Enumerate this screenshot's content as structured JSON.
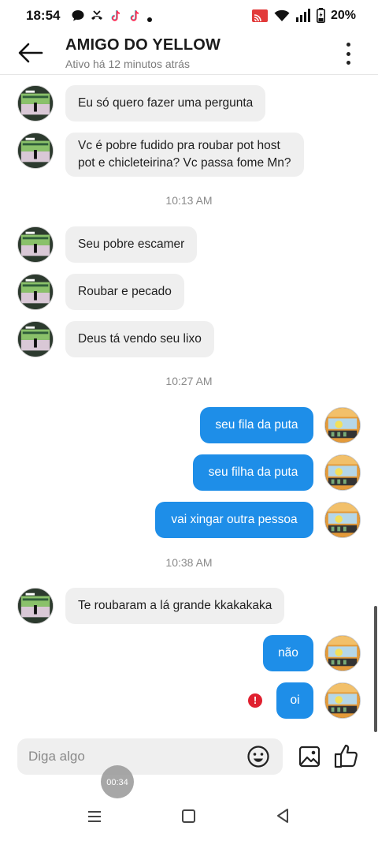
{
  "status_bar": {
    "time": "18:54",
    "battery": "20%",
    "notification_icons": [
      "chat-bubble-icon",
      "missed-call-icon",
      "tiktok-icon",
      "tiktok-icon",
      "dot-icon"
    ],
    "system_icons": [
      "cast-icon",
      "wifi-icon",
      "signal-icon",
      "battery-icon"
    ]
  },
  "header": {
    "name": "AMIGO DO YELLOW",
    "status": "Ativo há 12 minutos atrás"
  },
  "messages": [
    {
      "dir": "in",
      "text": "Eu só quero fazer uma pergunta"
    },
    {
      "dir": "in",
      "text_line1": "Vc é pobre fudido pra roubar pot host",
      "text_line2": "pot e chicleteirina? Vc passa fome Mn?"
    },
    {
      "dir": "time",
      "text": "10:13 AM"
    },
    {
      "dir": "in",
      "text": "Seu pobre escamer"
    },
    {
      "dir": "in",
      "text": "Roubar e pecado"
    },
    {
      "dir": "in",
      "text": "Deus tá vendo seu lixo"
    },
    {
      "dir": "time",
      "text": "10:27 AM"
    },
    {
      "dir": "out",
      "text": "seu fila da puta"
    },
    {
      "dir": "out",
      "text": "seu filha da puta"
    },
    {
      "dir": "out",
      "text": "vai xingar outra pessoa"
    },
    {
      "dir": "time",
      "text": "10:38 AM"
    },
    {
      "dir": "in",
      "text": "Te roubaram a lá grande kkakakaka"
    },
    {
      "dir": "out",
      "text": "não"
    },
    {
      "dir": "out",
      "text": "oi",
      "error": "!"
    }
  ],
  "composer": {
    "placeholder": "Diga algo"
  },
  "recording": {
    "time": "00:34"
  },
  "colors": {
    "outgoing_bubble": "#1e8ee8",
    "incoming_bubble": "#efefef",
    "error": "#e0202f"
  }
}
